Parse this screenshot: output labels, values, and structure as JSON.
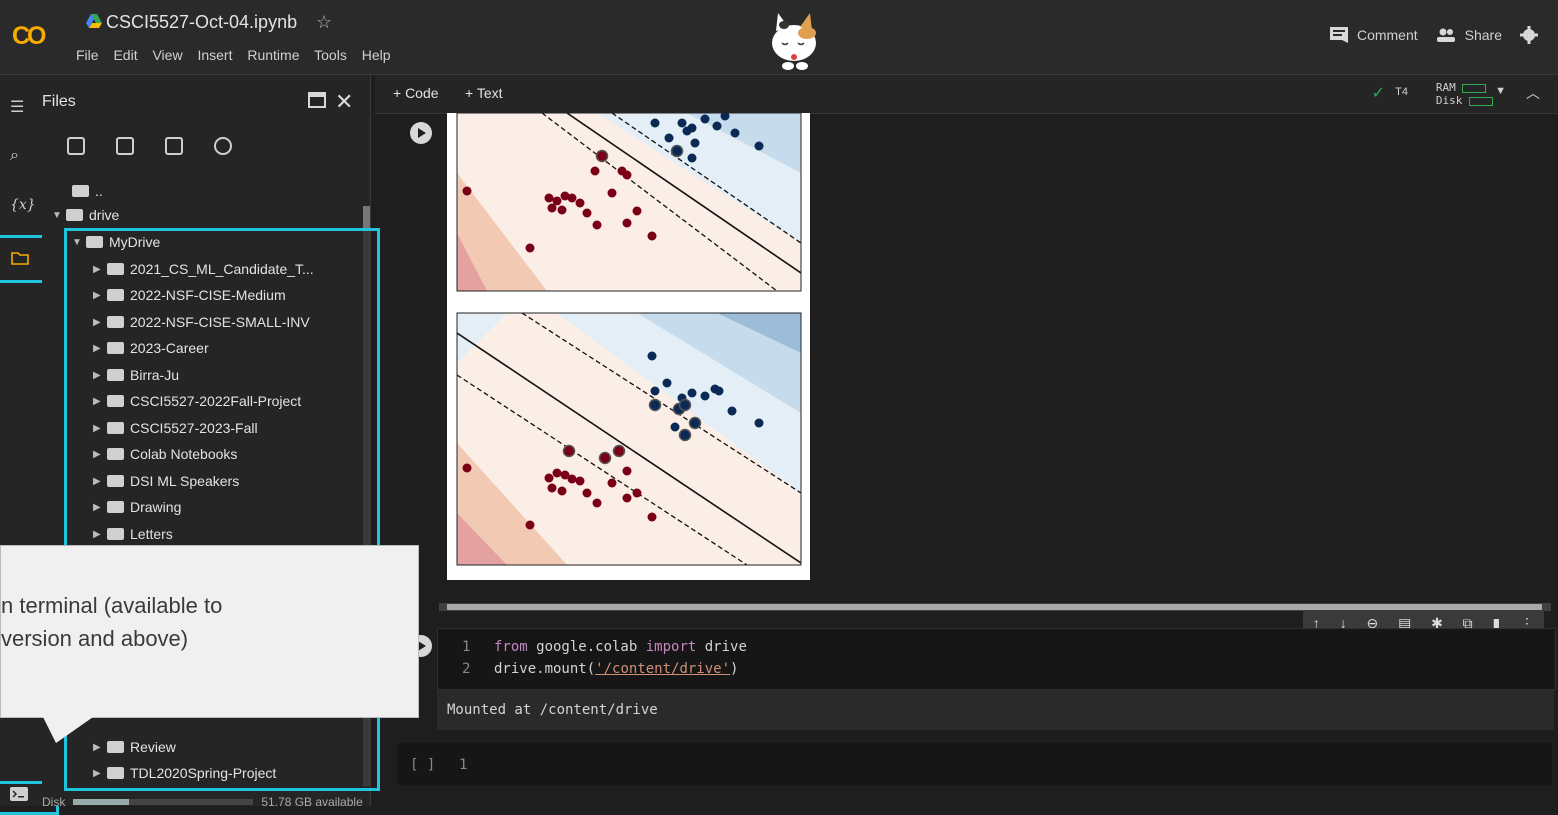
{
  "app": {
    "logo": "CO",
    "notebook_title": "CSCI5527-Oct-04.ipynb",
    "menu": [
      "File",
      "Edit",
      "View",
      "Insert",
      "Runtime",
      "Tools",
      "Help"
    ],
    "comment_label": "Comment",
    "share_label": "Share"
  },
  "toolbar": {
    "add_code": "+ Code",
    "add_text": "+ Text",
    "runtime_label": "T4",
    "ram_label": "RAM",
    "disk_label": "Disk"
  },
  "files_panel": {
    "title": "Files",
    "parent_dir": "..",
    "root_folder": "drive",
    "mydrive": "MyDrive",
    "folders": [
      "2021_CS_ML_Candidate_T...",
      "2022-NSF-CISE-Medium",
      "2022-NSF-CISE-SMALL-INV",
      "2023-Career",
      "Birra-Ju",
      "CSCI5527-2022Fall-Project",
      "CSCI5527-2023-Fall",
      "Colab Notebooks",
      "DSI ML Speakers",
      "Drawing",
      "Letters"
    ],
    "folders_bottom": [
      "Review",
      "TDL2020Spring-Project"
    ],
    "disk_label": "Disk",
    "disk_available": "51.78 GB available",
    "disk_used_fraction": 0.31
  },
  "code_cell": {
    "lines": [
      {
        "num": "1",
        "pre": "from",
        "mid": " google.colab ",
        "kw": "import",
        "post": " drive"
      },
      {
        "num": "2",
        "pre": "drive.mount(",
        "str": "'/content/drive'",
        "post": ")"
      }
    ],
    "output": "Mounted at /content/drive"
  },
  "empty_cell": {
    "brackets": "[ ]",
    "line_num": "1"
  },
  "tooltip": {
    "line1": "n terminal (available to",
    "line2": "version and above)"
  },
  "colors": {
    "accent_highlight": "#20c4dc",
    "logo": "#f9ab00",
    "connected": "#34a853"
  }
}
